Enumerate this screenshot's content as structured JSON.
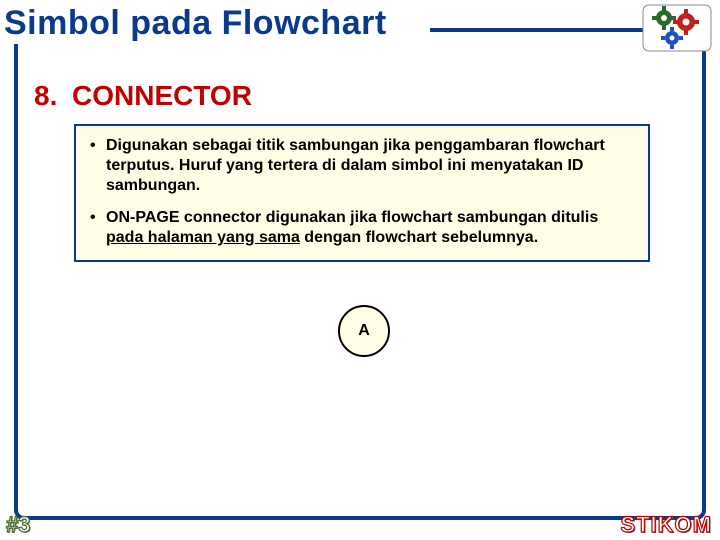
{
  "header": {
    "title": "Simbol pada Flowchart"
  },
  "section": {
    "number": "8.",
    "title": "CONNECTOR"
  },
  "bullets": [
    {
      "text": "Digunakan sebagai titik sambungan jika penggambaran flowchart terputus. Huruf yang tertera di dalam simbol ini menyatakan ID sambungan."
    },
    {
      "prefix": "ON-PAGE connector digunakan jika flowchart sambungan ditulis ",
      "underlined": "pada halaman yang sama",
      "suffix": " dengan flowchart sebelumnya."
    }
  ],
  "connector": {
    "label": "A"
  },
  "footer": {
    "left": "#3",
    "right": "STIKOM"
  }
}
